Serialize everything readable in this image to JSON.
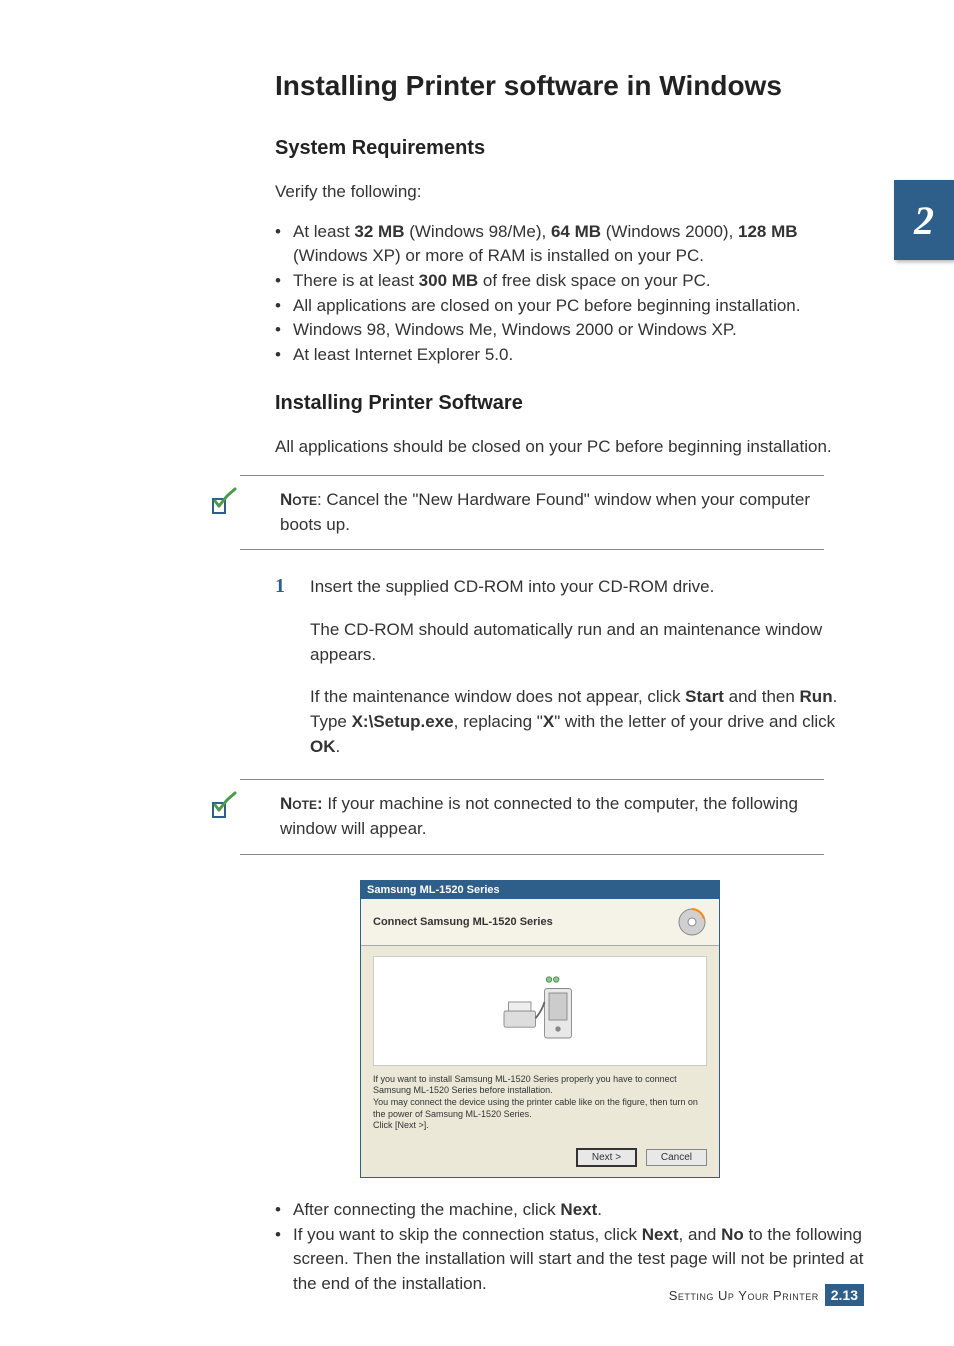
{
  "chapter_tab": "2",
  "main_title": "Installing Printer software in Windows",
  "section1_title": "System Requirements",
  "verify_text": "Verify the following:",
  "req_bullets": [
    {
      "pre": "At least ",
      "b1": "32 MB",
      "mid1": " (Windows 98/Me), ",
      "b2": "64 MB",
      "mid2": " (Windows 2000), ",
      "b3": "128 MB",
      "post": " (Windows XP) or more of RAM is installed on your PC."
    },
    {
      "pre": "There is at least ",
      "b1": "300 MB",
      "post": " of free disk space on your PC."
    },
    {
      "plain": "All applications are closed on your PC before beginning installation."
    },
    {
      "plain": "Windows 98, Windows Me, Windows 2000 or Windows XP."
    },
    {
      "plain": "At least Internet Explorer 5.0."
    }
  ],
  "section2_title": "Installing Printer Software",
  "section2_intro": "All applications should be closed on your PC before beginning installation.",
  "note1_label": "Note",
  "note1_text": ": Cancel the \"New Hardware Found\" window when your computer boots up.",
  "step1_number": "1",
  "step1_p1": "Insert the supplied CD-ROM into your CD-ROM drive.",
  "step1_p2": "The CD-ROM should automatically run and an maintenance window appears.",
  "step1_p3_pre": "If the maintenance window does not appear, click ",
  "step1_p3_b1": "Start",
  "step1_p3_mid1": " and then ",
  "step1_p3_b2": "Run",
  "step1_p3_mid2": ". Type ",
  "step1_p3_b3": "X:\\Setup.exe",
  "step1_p3_mid3": ", replacing \"",
  "step1_p3_b4": "X",
  "step1_p3_mid4": "\" with the letter of your drive and click ",
  "step1_p3_b5": "OK",
  "step1_p3_post": ".",
  "note2_label": "Note:",
  "note2_text": " If your machine is not connected to the computer, the following window will appear.",
  "dialog": {
    "titlebar": "Samsung ML-1520 Series",
    "header": "Connect Samsung ML-1520 Series",
    "instruction": "If you want to install Samsung ML-1520 Series properly you have to connect Samsung ML-1520 Series before installation.\nYou may connect the device using the printer cable like on the figure, then turn on the power of Samsung ML-1520 Series.\nClick [Next >].",
    "btn_next": "Next >",
    "btn_cancel": "Cancel"
  },
  "after_bullets": [
    {
      "pre": "After connecting the machine, click ",
      "b1": "Next",
      "post": "."
    },
    {
      "pre": "If you want to skip the connection status, click ",
      "b1": "Next",
      "mid": ", and ",
      "b2": "No",
      "post": " to the following screen. Then the installation will start and the test page will not be printed at the end of the installation."
    }
  ],
  "footer_text": "Setting Up Your Printer",
  "footer_chapter": "2.",
  "footer_page": "13"
}
